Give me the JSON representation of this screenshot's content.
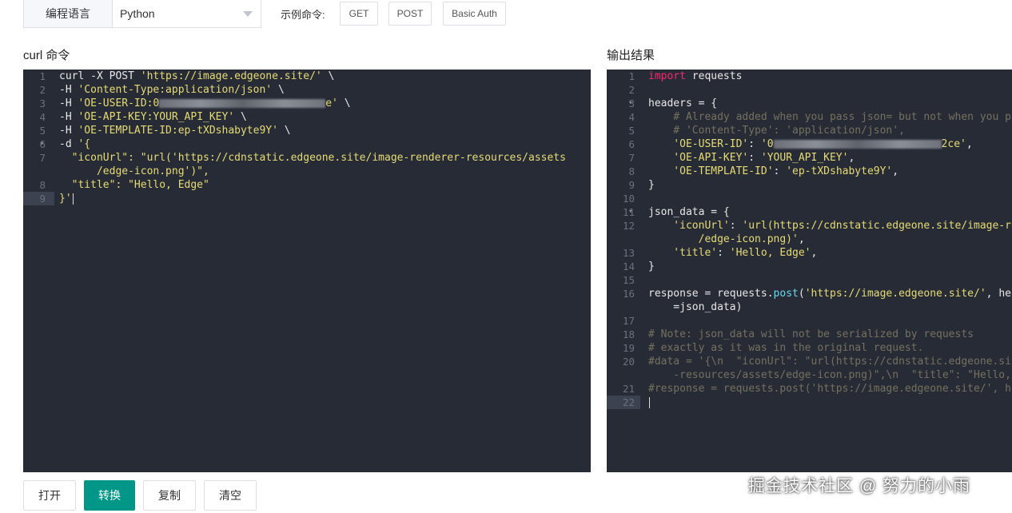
{
  "toolbar": {
    "lang_label": "编程语言",
    "lang_value": "Python",
    "example_label": "示例命令:",
    "examples": [
      "GET",
      "POST",
      "Basic Auth"
    ]
  },
  "curl_title": "curl 命令",
  "output_title": "输出结果",
  "left_code": [
    {
      "n": "1",
      "fold": false,
      "tokens": [
        [
          "pl",
          "curl -X POST "
        ],
        [
          "str",
          "'https://image.edgeone.site/'"
        ],
        [
          "pl",
          " \\"
        ]
      ]
    },
    {
      "n": "2",
      "fold": false,
      "tokens": [
        [
          "pl",
          "-H "
        ],
        [
          "str",
          "'Content-Type:application/json'"
        ],
        [
          "pl",
          " \\"
        ]
      ]
    },
    {
      "n": "3",
      "fold": false,
      "tokens": [
        [
          "pl",
          "-H "
        ],
        [
          "str",
          "'OE-USER-ID:0"
        ],
        [
          "redact",
          ""
        ],
        [
          "str",
          "e'"
        ],
        [
          "pl",
          " \\"
        ]
      ]
    },
    {
      "n": "4",
      "fold": false,
      "tokens": [
        [
          "pl",
          "-H "
        ],
        [
          "str",
          "'OE-API-KEY:YOUR_API_KEY'"
        ],
        [
          "pl",
          " \\"
        ]
      ]
    },
    {
      "n": "5",
      "fold": false,
      "tokens": [
        [
          "pl",
          "-H "
        ],
        [
          "str",
          "'OE-TEMPLATE-ID:ep-tXDshabyte9Y'"
        ],
        [
          "pl",
          " \\"
        ]
      ]
    },
    {
      "n": "6",
      "fold": true,
      "tokens": [
        [
          "pl",
          "-d "
        ],
        [
          "str",
          "'{"
        ]
      ]
    },
    {
      "n": "7",
      "fold": false,
      "tokens": [
        [
          "str",
          "  \"iconUrl\": \"url('https://cdnstatic.edgeone.site/image-renderer-resources/assets"
        ]
      ]
    },
    {
      "n": "",
      "fold": false,
      "tokens": [
        [
          "str",
          "      /edge-icon.png')\","
        ]
      ]
    },
    {
      "n": "8",
      "fold": false,
      "tokens": [
        [
          "str",
          "  \"title\": \"Hello, Edge\""
        ]
      ]
    },
    {
      "n": "9",
      "fold": false,
      "tokens": [
        [
          "str",
          "}'"
        ]
      ]
    }
  ],
  "right_code": [
    {
      "n": "1",
      "fold": false,
      "tokens": [
        [
          "kw",
          "import"
        ],
        [
          "pl",
          " requests"
        ]
      ]
    },
    {
      "n": "2",
      "fold": false,
      "tokens": []
    },
    {
      "n": "3",
      "fold": true,
      "tokens": [
        [
          "pl",
          "headers = {"
        ]
      ]
    },
    {
      "n": "4",
      "fold": false,
      "tokens": [
        [
          "cm",
          "    # Already added when you pass json= but not when you pa"
        ]
      ]
    },
    {
      "n": "5",
      "fold": false,
      "tokens": [
        [
          "cm",
          "    # 'Content-Type': 'application/json',"
        ]
      ]
    },
    {
      "n": "6",
      "fold": false,
      "tokens": [
        [
          "str",
          "    'OE-USER-ID'"
        ],
        [
          "pl",
          ": "
        ],
        [
          "str",
          "'0"
        ],
        [
          "redact",
          ""
        ],
        [
          "str",
          "2ce'"
        ],
        [
          "pl",
          ","
        ]
      ]
    },
    {
      "n": "7",
      "fold": false,
      "tokens": [
        [
          "str",
          "    'OE-API-KEY'"
        ],
        [
          "pl",
          ": "
        ],
        [
          "str",
          "'YOUR_API_KEY'"
        ],
        [
          "pl",
          ","
        ]
      ]
    },
    {
      "n": "8",
      "fold": false,
      "tokens": [
        [
          "str",
          "    'OE-TEMPLATE-ID'"
        ],
        [
          "pl",
          ": "
        ],
        [
          "str",
          "'ep-tXDshabyte9Y'"
        ],
        [
          "pl",
          ","
        ]
      ]
    },
    {
      "n": "9",
      "fold": false,
      "tokens": [
        [
          "pl",
          "}"
        ]
      ]
    },
    {
      "n": "10",
      "fold": false,
      "tokens": []
    },
    {
      "n": "11",
      "fold": true,
      "tokens": [
        [
          "pl",
          "json_data = {"
        ]
      ]
    },
    {
      "n": "12",
      "fold": false,
      "tokens": [
        [
          "str",
          "    'iconUrl'"
        ],
        [
          "pl",
          ": "
        ],
        [
          "str",
          "'url(https://cdnstatic.edgeone.site/image-re"
        ]
      ]
    },
    {
      "n": "",
      "fold": false,
      "tokens": [
        [
          "str",
          "        /edge-icon.png)'"
        ],
        [
          "pl",
          ","
        ]
      ]
    },
    {
      "n": "13",
      "fold": false,
      "tokens": [
        [
          "str",
          "    'title'"
        ],
        [
          "pl",
          ": "
        ],
        [
          "str",
          "'Hello, Edge'"
        ],
        [
          "pl",
          ","
        ]
      ]
    },
    {
      "n": "14",
      "fold": false,
      "tokens": [
        [
          "pl",
          "}"
        ]
      ]
    },
    {
      "n": "15",
      "fold": false,
      "tokens": []
    },
    {
      "n": "16",
      "fold": false,
      "tokens": [
        [
          "pl",
          "response = requests."
        ],
        [
          "fn",
          "post"
        ],
        [
          "pl",
          "("
        ],
        [
          "str",
          "'https://image.edgeone.site/'"
        ],
        [
          "pl",
          ", hea"
        ]
      ]
    },
    {
      "n": "",
      "fold": false,
      "tokens": [
        [
          "pl",
          "    =json_data)"
        ]
      ]
    },
    {
      "n": "17",
      "fold": false,
      "tokens": []
    },
    {
      "n": "18",
      "fold": false,
      "tokens": [
        [
          "cm",
          "# Note: json_data will not be serialized by requests"
        ]
      ]
    },
    {
      "n": "19",
      "fold": false,
      "tokens": [
        [
          "cm",
          "# exactly as it was in the original request."
        ]
      ]
    },
    {
      "n": "20",
      "fold": false,
      "tokens": [
        [
          "cm",
          "#data = '{\\n  \"iconUrl\": \"url(https://cdnstatic.edgeone.sit"
        ]
      ]
    },
    {
      "n": "",
      "fold": false,
      "tokens": [
        [
          "cm",
          "    -resources/assets/edge-icon.png)\",\\n  \"title\": \"Hello,"
        ]
      ]
    },
    {
      "n": "21",
      "fold": false,
      "tokens": [
        [
          "cm",
          "#response = requests.post('https://image.edgeone.site/', he"
        ]
      ]
    },
    {
      "n": "22",
      "fold": false,
      "tokens": []
    }
  ],
  "buttons": {
    "open": "打开",
    "convert": "转换",
    "copy": "复制",
    "clear": "清空"
  },
  "watermark": "掘金技术社区 @ 努力的小雨",
  "colors": {
    "primary": "#009688",
    "editor_bg": "#272b36"
  }
}
